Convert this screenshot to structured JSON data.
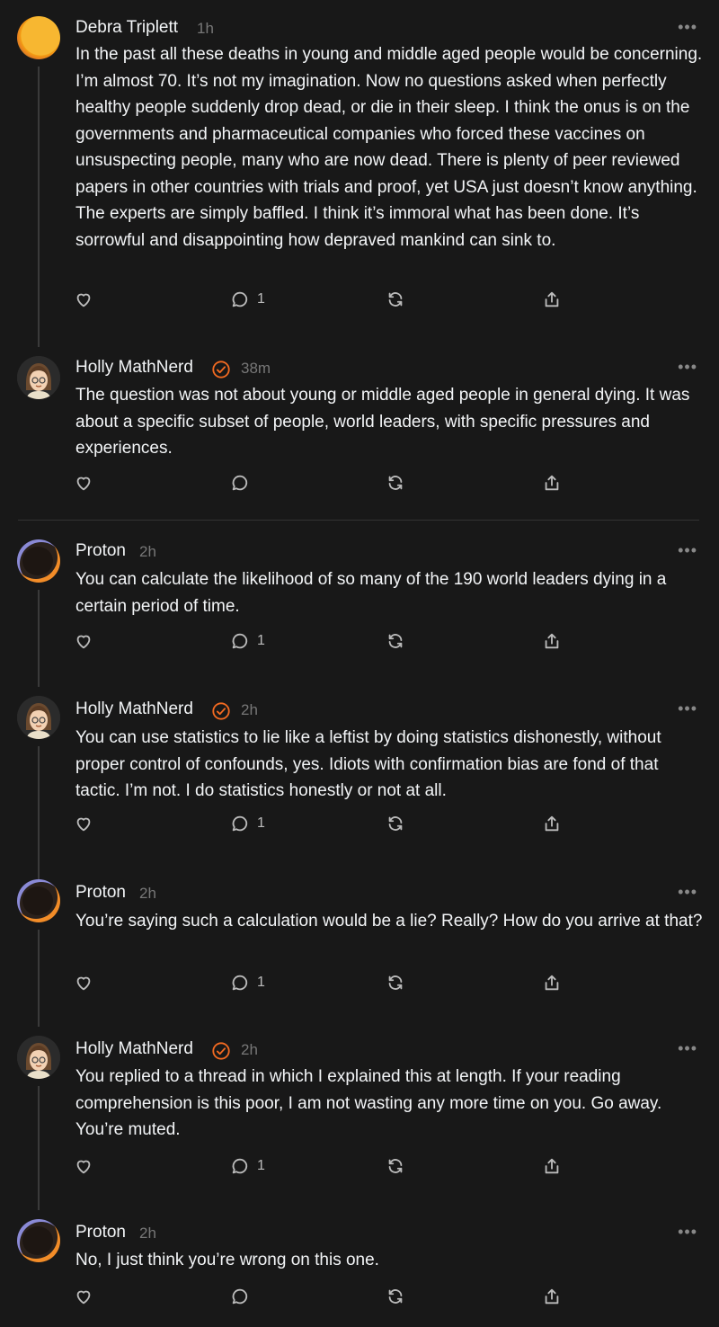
{
  "posts": [
    {
      "author": "Debra Triplett",
      "time": "1h",
      "verified": false,
      "avatar": "orange-circle-avatar",
      "text": "In the past all these deaths in young and middle aged people would be concerning. I’m almost 70. It’s not my imagination. Now no questions asked when perfectly healthy people suddenly drop dead, or die in their sleep. I think the onus is on the governments and pharmaceutical companies who forced these vaccines on unsuspecting people, many who are now dead. There is plenty of peer reviewed papers in other countries with trials and proof, yet USA just doesn’t know anything. The experts are simply baffled. I think it’s immoral what has been done. It’s sorrowful and disappointing how depraved mankind can sink to.",
      "reply_count": "1"
    },
    {
      "author": "Holly MathNerd",
      "time": "38m",
      "verified": true,
      "avatar": "memoji-avatar",
      "text": "The question was not about young or middle aged people in general dying. It was about a specific subset of people, world leaders, with specific pressures and experiences.",
      "reply_count": ""
    },
    {
      "author": "Proton",
      "time": "2h",
      "verified": false,
      "avatar": "dark-circle-avatar",
      "text": "You can calculate the likelihood of so many of the 190 world leaders dying in a certain period of time.",
      "reply_count": "1"
    },
    {
      "author": "Holly MathNerd",
      "time": "2h",
      "verified": true,
      "avatar": "memoji-avatar",
      "text": "You can use statistics to lie like a leftist by doing statistics dishonestly, without proper control of confounds, yes. Idiots with confirmation bias are fond of that tactic. I’m not. I do statistics honestly or not at all.",
      "reply_count": "1"
    },
    {
      "author": "Proton",
      "time": "2h",
      "verified": false,
      "avatar": "dark-circle-avatar",
      "text": "You’re saying such a calculation would be a lie? Really? How do you arrive at that?",
      "reply_count": "1"
    },
    {
      "author": "Holly MathNerd",
      "time": "2h",
      "verified": true,
      "avatar": "memoji-avatar",
      "text": "You replied to a thread in which I explained this at length. If your reading comprehension is this poor, I am not wasting any more time on you. Go away. You’re muted.",
      "reply_count": "1"
    },
    {
      "author": "Proton",
      "time": "2h",
      "verified": false,
      "avatar": "dark-circle-avatar",
      "text": "No, I just think you’re wrong on this one.",
      "reply_count": ""
    }
  ],
  "more_label": "•••",
  "colors": {
    "background": "#181818",
    "verified": "#f26a21",
    "text": "#f3f5f7",
    "muted": "#777777"
  }
}
